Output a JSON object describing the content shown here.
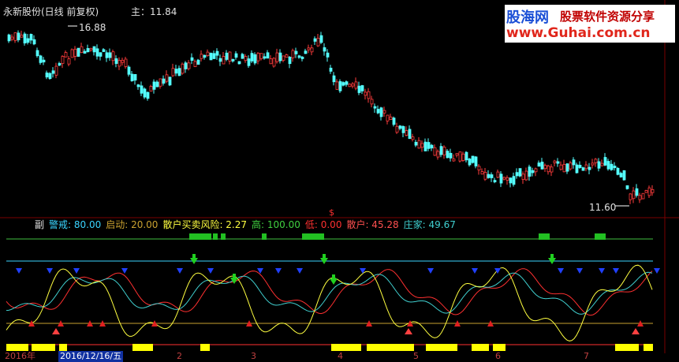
{
  "main_panel": {
    "title": "永新股份(日线 前复权)",
    "main_label": "主：11.84",
    "high_marker": "16.88",
    "low_marker": "11.60"
  },
  "logo": {
    "brand": "股海网",
    "slogan": "股票软件资源分享",
    "url": "www.Guhai.com.cn"
  },
  "sub_panel": {
    "label": "副",
    "legend": [
      {
        "name": "警戒",
        "value": "80.00",
        "color": "#3ad4ff"
      },
      {
        "name": "启动",
        "value": "20.00",
        "color": "#c8a030"
      },
      {
        "name": "散户买卖风险",
        "value": "2.27",
        "color": "#ffff40"
      },
      {
        "name": "高",
        "value": "100.00",
        "color": "#40d040"
      },
      {
        "name": "低",
        "value": "0.00",
        "color": "#ff3030"
      },
      {
        "name": "散户",
        "value": "45.28",
        "color": "#ff5050"
      },
      {
        "name": "庄家",
        "value": "49.67",
        "color": "#40d0d0"
      }
    ],
    "dollar_marker": "$"
  },
  "timeline": {
    "year_label": "2016年",
    "date_label": "2016/12/16/五",
    "month_ticks": [
      "2",
      "3",
      "4",
      "5",
      "6",
      "7"
    ]
  }
}
